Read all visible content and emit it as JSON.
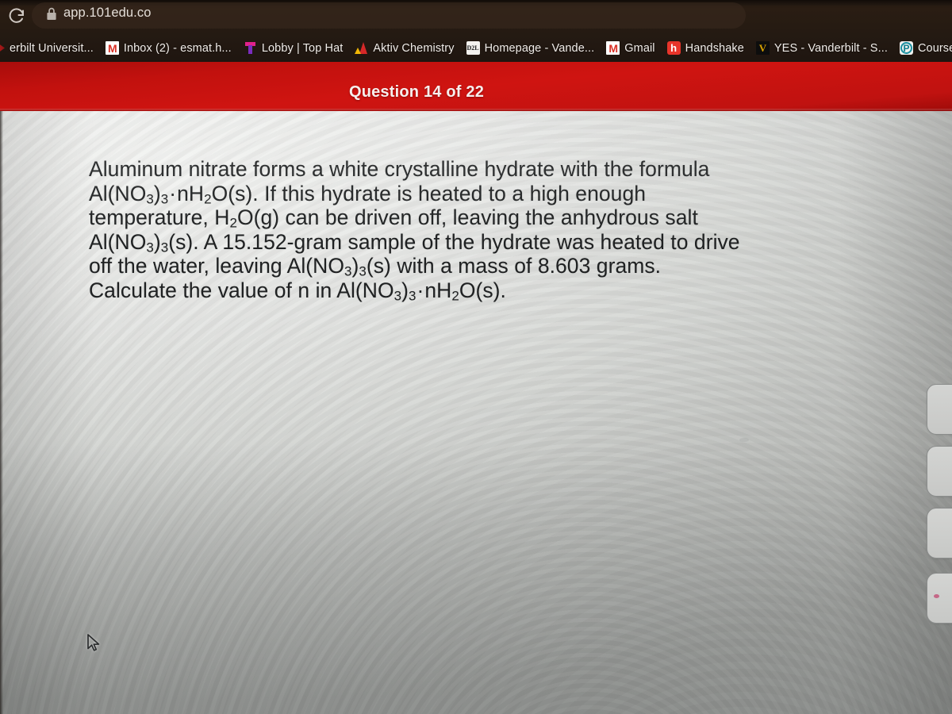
{
  "browser": {
    "url": "app.101edu.co",
    "reload_icon": "reload-icon",
    "lock_icon": "lock-icon",
    "bookmarks": [
      {
        "label": "erbilt Universit...",
        "icon": "vanderbilt-icon"
      },
      {
        "label": "Inbox (2) - esmat.h...",
        "icon": "gmail-icon"
      },
      {
        "label": "Lobby | Top Hat",
        "icon": "tophat-icon"
      },
      {
        "label": "Aktiv Chemistry",
        "icon": "aktiv-chemistry-icon"
      },
      {
        "label": "Homepage - Vande...",
        "icon": "d2l-icon"
      },
      {
        "label": "Gmail",
        "icon": "gmail-icon"
      },
      {
        "label": "Handshake",
        "icon": "handshake-icon"
      },
      {
        "label": "YES - Vanderbilt - S...",
        "icon": "yes-vanderbilt-icon"
      },
      {
        "label": "Course Hom",
        "icon": "pearson-icon"
      }
    ]
  },
  "app": {
    "header": {
      "question_counter": "Question 14 of 22",
      "background_color": "#c2110e"
    },
    "question": {
      "lines": [
        "Aluminum nitrate forms a white crystalline hydrate with the formula",
        "Al(NO3)3·nH2O(s). If this hydrate is heated to a high enough",
        "temperature, H2O(g) can be driven off, leaving the anhydrous salt",
        "Al(NO3)3(s). A 15.152-gram sample of the hydrate was heated to drive",
        "off the water, leaving Al(NO3)3(s) with a mass of 8.603 grams.",
        "Calculate the value of n in Al(NO3)3·nH2O(s)."
      ],
      "full_text": "Aluminum nitrate forms a white crystalline hydrate with the formula Al(NO3)3·nH2O(s). If this hydrate is heated to a high enough temperature, H2O(g) can be driven off, leaving the anhydrous salt Al(NO3)3(s). A 15.152-gram sample of the hydrate was heated to drive off the water, leaving Al(NO3)3(s) with a mass of 8.603 grams. Calculate the value of n in Al(NO3)3·nH2O(s).",
      "values": {
        "hydrate_mass_g": "15.152",
        "anhydrous_mass_g": "8.603",
        "unknown": "n"
      },
      "text_color": "#1f2122"
    },
    "side_buttons": [
      {
        "name": "side-button-1",
        "label": ""
      },
      {
        "name": "side-button-2",
        "label": ""
      },
      {
        "name": "side-button-3",
        "label": ""
      },
      {
        "name": "side-button-4",
        "label": ""
      }
    ]
  },
  "cursor": {
    "icon": "mouse-pointer-icon"
  }
}
